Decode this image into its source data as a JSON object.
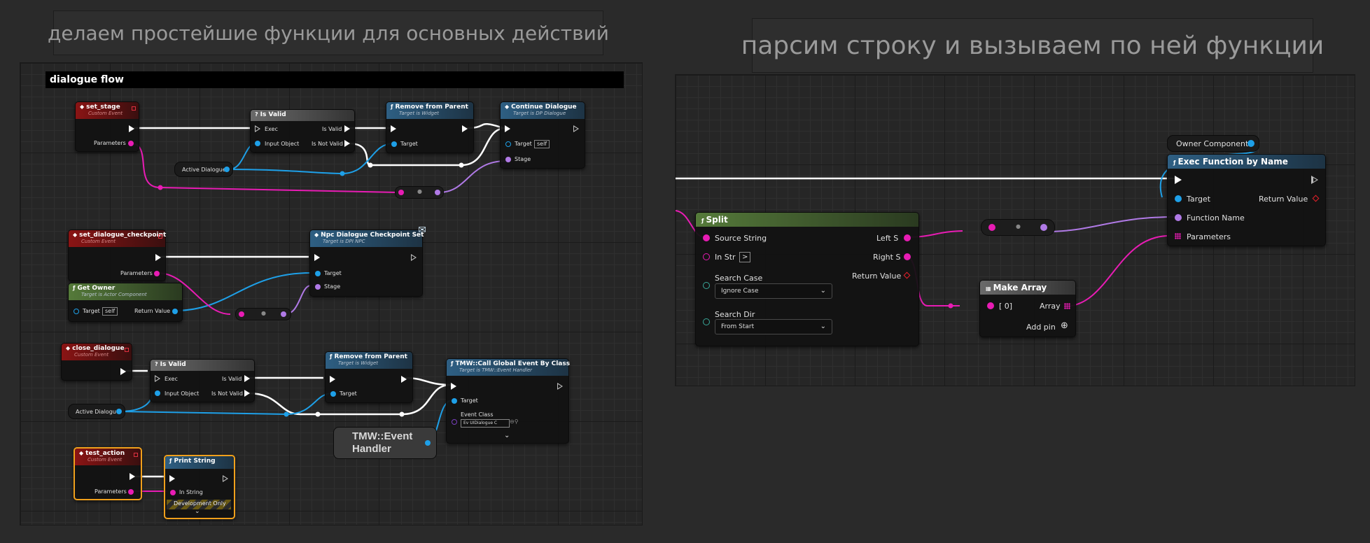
{
  "banners": {
    "left": "делаем простейшие функции для основных действий",
    "right": "парсим строку и вызываем по ней функции"
  },
  "left_panel": {
    "comment": "dialogue flow",
    "set_stage": {
      "title": "set_stage",
      "subtitle": "Custom Event",
      "params": "Parameters"
    },
    "is_valid_1": {
      "title": "Is Valid",
      "exec": "Exec",
      "input": "Input Object",
      "valid": "Is Valid",
      "not_valid": "Is Not Valid"
    },
    "remove_parent_1": {
      "title": "Remove from Parent",
      "subtitle": "Target is Widget",
      "target": "Target"
    },
    "continue_dialogue": {
      "title": "Continue Dialogue",
      "subtitle": "Target is DP Dialogue",
      "target": "Target",
      "target_value": "self",
      "stage": "Stage"
    },
    "active_dialogue_1": "Active Dialogue",
    "set_checkpoint": {
      "title": "set_dialogue_checkpoint",
      "subtitle": "Custom Event",
      "params": "Parameters"
    },
    "npc_checkpoint": {
      "title": "Npc Dialogue Checkpoint Set",
      "subtitle": "Target is DPI NPC",
      "target": "Target",
      "stage": "Stage"
    },
    "get_owner": {
      "title": "Get Owner",
      "subtitle": "Target is Actor Component",
      "target": "Target",
      "target_value": "self",
      "return": "Return Value"
    },
    "close_dialogue": {
      "title": "close_dialogue",
      "subtitle": "Custom Event"
    },
    "is_valid_2": {
      "title": "Is Valid",
      "exec": "Exec",
      "input": "Input Object",
      "valid": "Is Valid",
      "not_valid": "Is Not Valid"
    },
    "remove_parent_2": {
      "title": "Remove from Parent",
      "subtitle": "Target is Widget",
      "target": "Target"
    },
    "call_global": {
      "title": "TMW::Call Global Event By Class",
      "subtitle": "Target is TMW::Event Handler",
      "target": "Target",
      "event_class": "Event Class",
      "event_class_value": "Ev UIDialogue C"
    },
    "active_dialogue_2": "Active Dialogue",
    "event_handler": "TMW::Event Handler",
    "test_action": {
      "title": "test_action",
      "subtitle": "Custom Event",
      "params": "Parameters"
    },
    "print_string": {
      "title": "Print String",
      "in_string": "In String",
      "dev_only": "Development Only"
    }
  },
  "right_panel": {
    "owner_component": "Owner Component",
    "exec_by_name": {
      "title": "Exec Function by Name",
      "target": "Target",
      "return": "Return Value",
      "function_name": "Function Name",
      "parameters": "Parameters"
    },
    "split": {
      "title": "Split",
      "source": "Source String",
      "in_str": "In Str",
      "in_str_value": ">",
      "search_case": "Search Case",
      "search_case_value": "Ignore Case",
      "search_dir": "Search Dir",
      "search_dir_value": "From Start",
      "left": "Left S",
      "right": "Right S",
      "return": "Return Value"
    },
    "make_array": {
      "title": "Make Array",
      "index0": "[ 0]",
      "array": "Array",
      "add_pin": "Add pin"
    }
  },
  "colors": {
    "exec": "#ffffff",
    "string": "#e81cb4",
    "object": "#1ea0e8",
    "name": "#b07ae6",
    "selection": "#f0a01c"
  }
}
